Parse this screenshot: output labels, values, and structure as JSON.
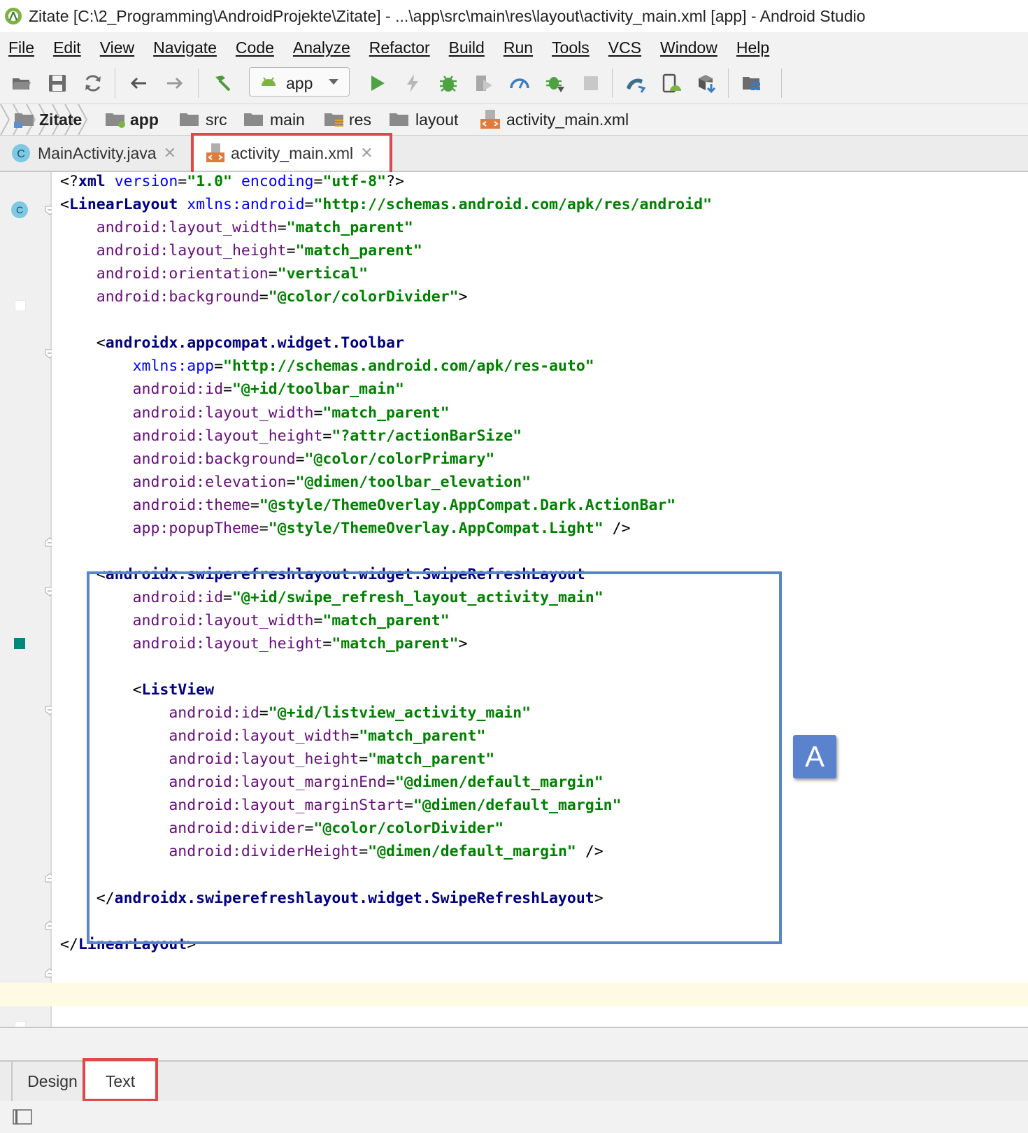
{
  "window": {
    "title": "Zitate [C:\\2_Programming\\AndroidProjekte\\Zitate] - ...\\app\\src\\main\\res\\layout\\activity_main.xml [app] - Android Studio"
  },
  "menu": [
    "File",
    "Edit",
    "View",
    "Navigate",
    "Code",
    "Analyze",
    "Refactor",
    "Build",
    "Run",
    "Tools",
    "VCS",
    "Window",
    "Help"
  ],
  "toolbar": {
    "run_config": "app",
    "icons": [
      "open-folder-icon",
      "save-icon",
      "sync-icon",
      "back-arrow-icon",
      "forward-arrow-icon",
      "build-hammer-icon",
      "run-config-dropdown",
      "run-icon",
      "apply-changes-icon",
      "debug-icon",
      "coverage-icon",
      "profile-icon",
      "attach-debugger-icon",
      "stop-icon",
      "gradle-sync-icon",
      "avd-manager-icon",
      "sdk-manager-icon",
      "project-structure-icon"
    ]
  },
  "breadcrumb": [
    "Zitate",
    "app",
    "src",
    "main",
    "res",
    "layout",
    "activity_main.xml"
  ],
  "tabs": [
    {
      "label": "MainActivity.java",
      "active": false
    },
    {
      "label": "activity_main.xml",
      "active": true
    }
  ],
  "code_lines": [
    "<?xml version=\"1.0\" encoding=\"utf-8\"?>",
    "<LinearLayout xmlns:android=\"http://schemas.android.com/apk/res/android\"",
    "    android:layout_width=\"match_parent\"",
    "    android:layout_height=\"match_parent\"",
    "    android:orientation=\"vertical\"",
    "    android:background=\"@color/colorDivider\">",
    "",
    "    <androidx.appcompat.widget.Toolbar",
    "        xmlns:app=\"http://schemas.android.com/apk/res-auto\"",
    "        android:id=\"@+id/toolbar_main\"",
    "        android:layout_width=\"match_parent\"",
    "        android:layout_height=\"?attr/actionBarSize\"",
    "        android:background=\"@color/colorPrimary\"",
    "        android:elevation=\"@dimen/toolbar_elevation\"",
    "        android:theme=\"@style/ThemeOverlay.AppCompat.Dark.ActionBar\"",
    "        app:popupTheme=\"@style/ThemeOverlay.AppCompat.Light\" />",
    "",
    "    <androidx.swiperefreshlayout.widget.SwipeRefreshLayout",
    "        android:id=\"@+id/swipe_refresh_layout_activity_main\"",
    "        android:layout_width=\"match_parent\"",
    "        android:layout_height=\"match_parent\">",
    "",
    "        <ListView",
    "            android:id=\"@+id/listview_activity_main\"",
    "            android:layout_width=\"match_parent\"",
    "            android:layout_height=\"match_parent\"",
    "            android:layout_marginEnd=\"@dimen/default_margin\"",
    "            android:layout_marginStart=\"@dimen/default_margin\"",
    "            android:divider=\"@color/colorDivider\"",
    "            android:dividerHeight=\"@dimen/default_margin\" />",
    "",
    "    </androidx.swiperefreshlayout.widget.SwipeRefreshLayout>",
    "",
    "</LinearLayout>"
  ],
  "annotation_badge": "A",
  "bottom_tabs": [
    {
      "label": "Design",
      "active": false
    },
    {
      "label": "Text",
      "active": true
    }
  ],
  "colors": {
    "highlight_red": "#e0474c",
    "highlight_blue": "#5a86c9",
    "badge_blue": "#5b82cc",
    "color_primary_swatch": "#00897b"
  }
}
